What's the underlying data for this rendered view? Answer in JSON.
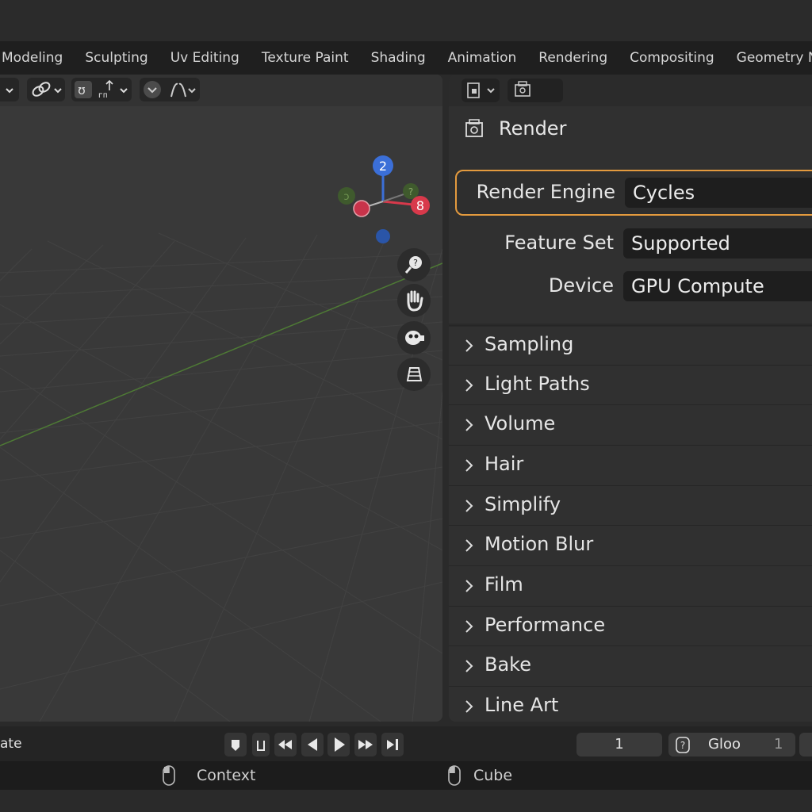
{
  "workspace_tabs": [
    "Modeling",
    "Sculpting",
    "Uv Editing",
    "Texture Paint",
    "Shading",
    "Animation",
    "Rendering",
    "Compositing",
    "Geometry Node"
  ],
  "viewport": {
    "gizmo": {
      "z_label": "2",
      "x_label": "8",
      "y_label": "?",
      "neg_y_label": "ɔ"
    },
    "nav_icons": [
      "zoom-icon",
      "hand-pan-icon",
      "camera-icon",
      "grid-view-icon"
    ]
  },
  "properties": {
    "header_icons": [
      "editor-type-icon",
      "render-properties-icon"
    ],
    "title": "Render",
    "fields": [
      {
        "label": "Render Engine",
        "value": "Cycles"
      },
      {
        "label": "Feature Set",
        "value": "Supported"
      },
      {
        "label": "Device",
        "value": "GPU Compute"
      }
    ],
    "sections": [
      "Sampling",
      "Light Paths",
      "Volume",
      "Hair",
      "Simplify",
      "Motion Blur",
      "Film",
      "Performance",
      "Bake",
      "Line Art"
    ]
  },
  "timeline": {
    "left_label": "ate",
    "current_frame": "1",
    "scene_name": "Gloo",
    "scene_number": "1"
  },
  "statusbar": {
    "left_hint": "Context",
    "right_hint": "Cube"
  },
  "colors": {
    "highlight": "#e39a3e",
    "axis_x": "#d8394b",
    "axis_y": "#5b8a3a",
    "axis_z": "#3b6fd8"
  }
}
